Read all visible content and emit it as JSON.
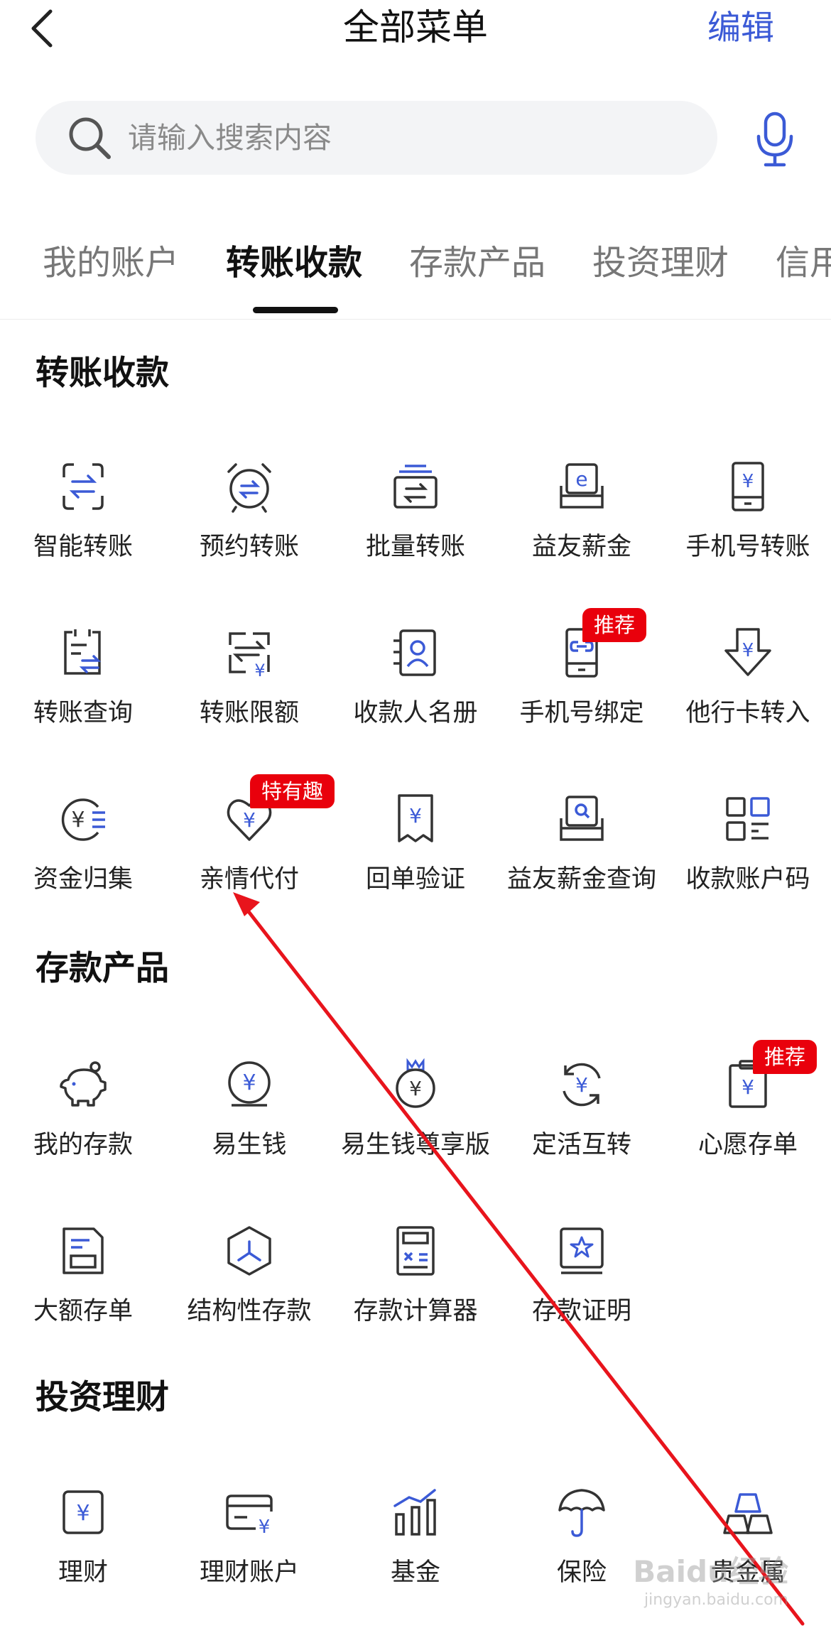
{
  "header": {
    "title": "全部菜单",
    "edit_label": "编辑"
  },
  "search": {
    "placeholder": "请输入搜索内容"
  },
  "tabs": [
    {
      "label": "我的账户"
    },
    {
      "label": "转账收款",
      "active": true
    },
    {
      "label": "存款产品"
    },
    {
      "label": "投资理财"
    },
    {
      "label": "信用"
    }
  ],
  "sections": {
    "transfer": {
      "title": "转账收款",
      "items": [
        {
          "label": "智能转账",
          "icon": "smart-transfer-icon"
        },
        {
          "label": "预约转账",
          "icon": "scheduled-transfer-icon"
        },
        {
          "label": "批量转账",
          "icon": "batch-transfer-icon"
        },
        {
          "label": "益友薪金",
          "icon": "salary-icon"
        },
        {
          "label": "手机号转账",
          "icon": "phone-transfer-icon"
        },
        {
          "label": "转账查询",
          "icon": "transfer-query-icon"
        },
        {
          "label": "转账限额",
          "icon": "transfer-limit-icon"
        },
        {
          "label": "收款人名册",
          "icon": "payee-list-icon"
        },
        {
          "label": "手机号绑定",
          "icon": "phone-bind-icon",
          "badge": "推荐"
        },
        {
          "label": "他行卡转入",
          "icon": "other-bank-in-icon"
        },
        {
          "label": "资金归集",
          "icon": "fund-collect-icon"
        },
        {
          "label": "亲情代付",
          "icon": "family-pay-icon",
          "badge": "特有趣"
        },
        {
          "label": "回单验证",
          "icon": "receipt-verify-icon"
        },
        {
          "label": "益友薪金查询",
          "icon": "salary-query-icon"
        },
        {
          "label": "收款账户码",
          "icon": "account-qr-icon"
        }
      ]
    },
    "deposit": {
      "title": "存款产品",
      "items": [
        {
          "label": "我的存款",
          "icon": "piggy-bank-icon"
        },
        {
          "label": "易生钱",
          "icon": "yi-money-icon"
        },
        {
          "label": "易生钱尊享版",
          "icon": "yi-money-vip-icon"
        },
        {
          "label": "定活互转",
          "icon": "fixed-current-swap-icon"
        },
        {
          "label": "心愿存单",
          "icon": "wish-deposit-icon",
          "badge": "推荐"
        },
        {
          "label": "大额存单",
          "icon": "large-deposit-icon"
        },
        {
          "label": "结构性存款",
          "icon": "structured-deposit-icon"
        },
        {
          "label": "存款计算器",
          "icon": "calculator-icon"
        },
        {
          "label": "存款证明",
          "icon": "deposit-certificate-icon"
        }
      ]
    },
    "invest": {
      "title": "投资理财",
      "items": [
        {
          "label": "理财",
          "icon": "wealth-icon"
        },
        {
          "label": "理财账户",
          "icon": "wealth-account-icon"
        },
        {
          "label": "基金",
          "icon": "fund-chart-icon"
        },
        {
          "label": "保险",
          "icon": "umbrella-icon"
        },
        {
          "label": "贵金属",
          "icon": "gold-bars-icon"
        }
      ]
    }
  },
  "colors": {
    "accent": "#3b5ad6",
    "badge": "#e9000c",
    "icon_stroke": "#333333",
    "annotation_arrow": "#e8141c"
  },
  "watermark": {
    "text": "Baidu经验",
    "subtext": "jingyan.baidu.com"
  }
}
